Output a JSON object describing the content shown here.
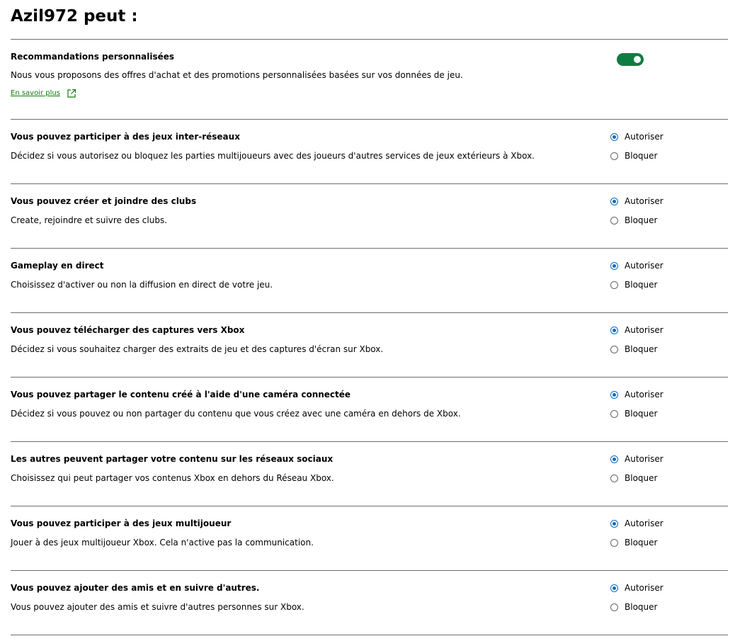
{
  "page": {
    "title": "Azil972 peut :"
  },
  "personalized": {
    "title": "Recommandations personnalisées",
    "description": "Nous vous proposons des offres d'achat et des promotions personnalisées basées sur vos données de jeu.",
    "link_label": "En savoir plus",
    "toggle_on": true
  },
  "radio_labels": {
    "allow": "Autoriser",
    "block": "Bloquer"
  },
  "settings": [
    {
      "title": "Vous pouvez participer à des jeux inter-réseaux",
      "description": "Décidez si vous autorisez ou bloquez les parties multijoueurs avec des joueurs d'autres services de jeux extérieurs à Xbox.",
      "selected": "Autoriser"
    },
    {
      "title": "Vous pouvez créer et joindre des clubs",
      "description": "Create, rejoindre et suivre des clubs.",
      "selected": "Autoriser"
    },
    {
      "title": "Gameplay en direct",
      "description": "Choisissez d'activer ou non la diffusion en direct de votre jeu.",
      "selected": "Autoriser"
    },
    {
      "title": "Vous pouvez télécharger des captures vers Xbox",
      "description": "Décidez si vous souhaitez charger des extraits de jeu et des captures d'écran sur Xbox.",
      "selected": "Autoriser"
    },
    {
      "title": "Vous pouvez partager le contenu créé à l'aide d'une caméra connectée",
      "description": "Décidez si vous pouvez ou non partager du contenu que vous créez avec une caméra en dehors de Xbox.",
      "selected": "Autoriser"
    },
    {
      "title": "Les autres peuvent partager votre contenu sur les réseaux sociaux",
      "description": "Choisissez qui peut partager vos contenus Xbox en dehors du Réseau Xbox.",
      "selected": "Autoriser"
    },
    {
      "title": "Vous pouvez participer à des jeux multijoueur",
      "description": "Jouer à des jeux multijoueur Xbox. Cela n'active pas la communication.",
      "selected": "Autoriser"
    },
    {
      "title": "Vous pouvez ajouter des amis et en suivre d'autres.",
      "description": "Vous pouvez ajouter des amis et suivre d'autres personnes sur Xbox.",
      "selected": "Autoriser"
    }
  ],
  "icons": {
    "external_link": "external-link-icon"
  },
  "colors": {
    "toggle_on": "#107c41",
    "radio_selected": "#0f6cbd",
    "link": "#107c10",
    "divider": "#6e6e6e"
  }
}
